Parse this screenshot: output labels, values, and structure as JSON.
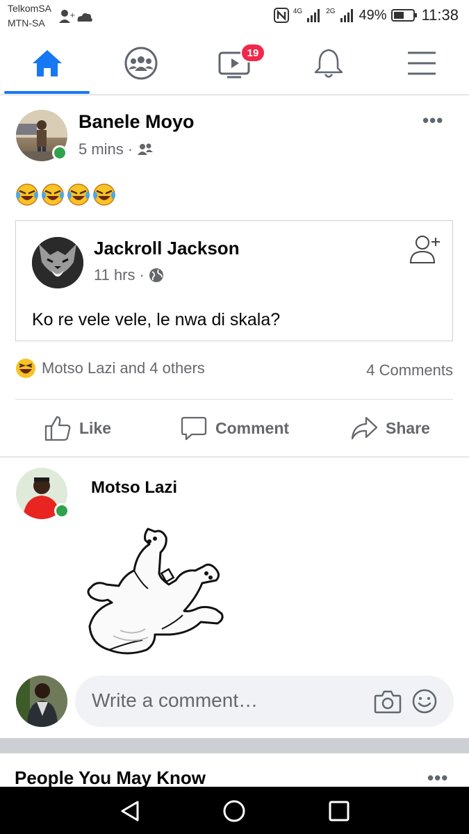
{
  "status_bar": {
    "carrier_1": "TelkomSA",
    "carrier_2": "MTN-SA",
    "net_1": "4G",
    "net_2": "2G",
    "battery": "49%",
    "time": "11:38"
  },
  "nav": {
    "items": [
      {
        "name": "home",
        "icon": "home-icon",
        "active": true
      },
      {
        "name": "groups",
        "icon": "groups-icon"
      },
      {
        "name": "watch",
        "icon": "video-icon",
        "badge": "19"
      },
      {
        "name": "notifications",
        "icon": "bell-icon"
      },
      {
        "name": "menu",
        "icon": "hamburger-icon"
      }
    ],
    "accent": "#1877f2",
    "badge_color": "#f02849"
  },
  "post": {
    "author": "Banele Moyo",
    "time": "5 mins",
    "audience_icon": "friends-icon",
    "more": "•••",
    "emojis": [
      "rolling-on-floor-laughing",
      "rolling-on-floor-laughing",
      "rolling-on-floor-laughing",
      "rolling-on-floor-laughing"
    ],
    "shared": {
      "author": "Jackroll Jackson",
      "time": "11 hrs",
      "audience_icon": "globe-icon",
      "text": "Ko re vele vele, le nwa di skala?"
    },
    "reactions": {
      "text": "Motso Lazi and 4 others",
      "comments": "4 Comments"
    },
    "actions": {
      "like": "Like",
      "comment": "Comment",
      "share": "Share"
    }
  },
  "comment": {
    "author": "Motso Lazi",
    "sticker": "dancing-polar-bear-sticker"
  },
  "composer": {
    "placeholder": "Write a comment…"
  },
  "pymk": {
    "title": "People You May Know",
    "more": "•••"
  }
}
